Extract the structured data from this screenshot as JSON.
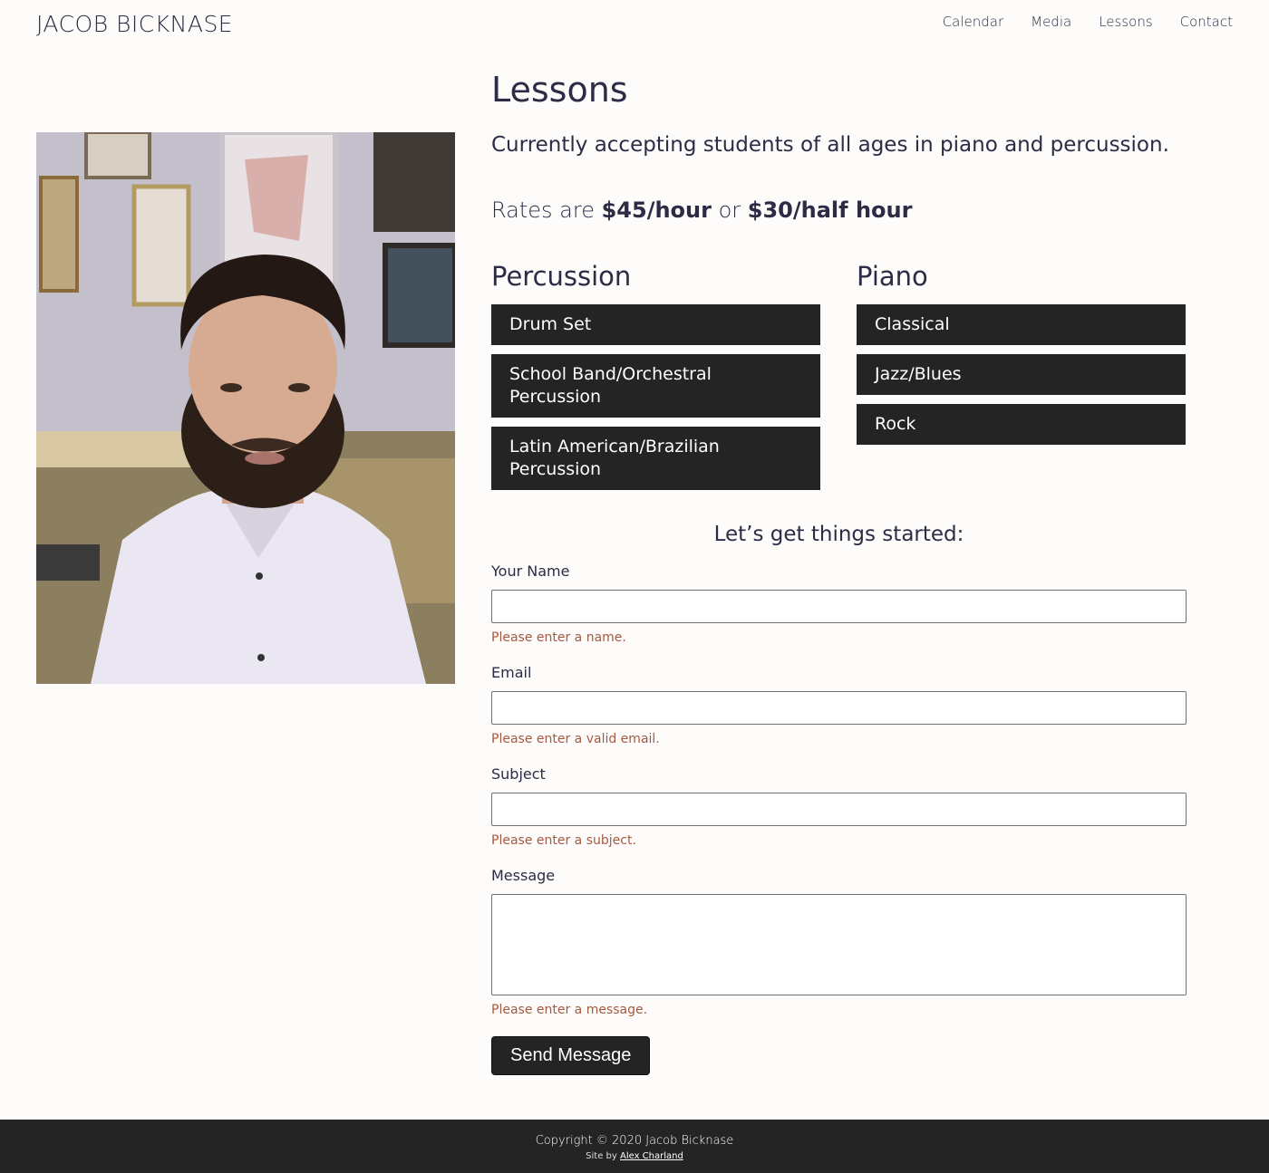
{
  "header": {
    "site_title": "JACOB BICKNASE",
    "nav": [
      "Calendar",
      "Media",
      "Lessons",
      "Contact"
    ]
  },
  "main": {
    "title": "Lessons",
    "lead": "Currently accepting students of all ages in piano and percussion.",
    "rates": {
      "prefix": "Rates are ",
      "hour": "$45/hour",
      "or": " or ",
      "half": "$30/half hour"
    },
    "percussion": {
      "heading": "Percussion",
      "items": [
        "Drum Set",
        "School Band/Orchestral Percussion",
        "Latin American/Brazilian Percussion"
      ]
    },
    "piano": {
      "heading": "Piano",
      "items": [
        "Classical",
        "Jazz/Blues",
        "Rock"
      ]
    }
  },
  "form": {
    "heading": "Let’s get things started:",
    "name_label": "Your Name",
    "name_error": "Please enter a name.",
    "email_label": "Email",
    "email_error": "Please enter a valid email.",
    "subject_label": "Subject",
    "subject_error": "Please enter a subject.",
    "message_label": "Message",
    "message_error": "Please enter a message.",
    "send_label": "Send Message"
  },
  "footer": {
    "copyright": "Copyright © 2020 Jacob Bicknase",
    "credit_prefix": "Site by ",
    "credit_link": "Alex Charland"
  },
  "colors": {
    "background": "#fdfcfb",
    "text": "#2d2b45",
    "dark": "#242424",
    "error": "#a55a3f"
  }
}
